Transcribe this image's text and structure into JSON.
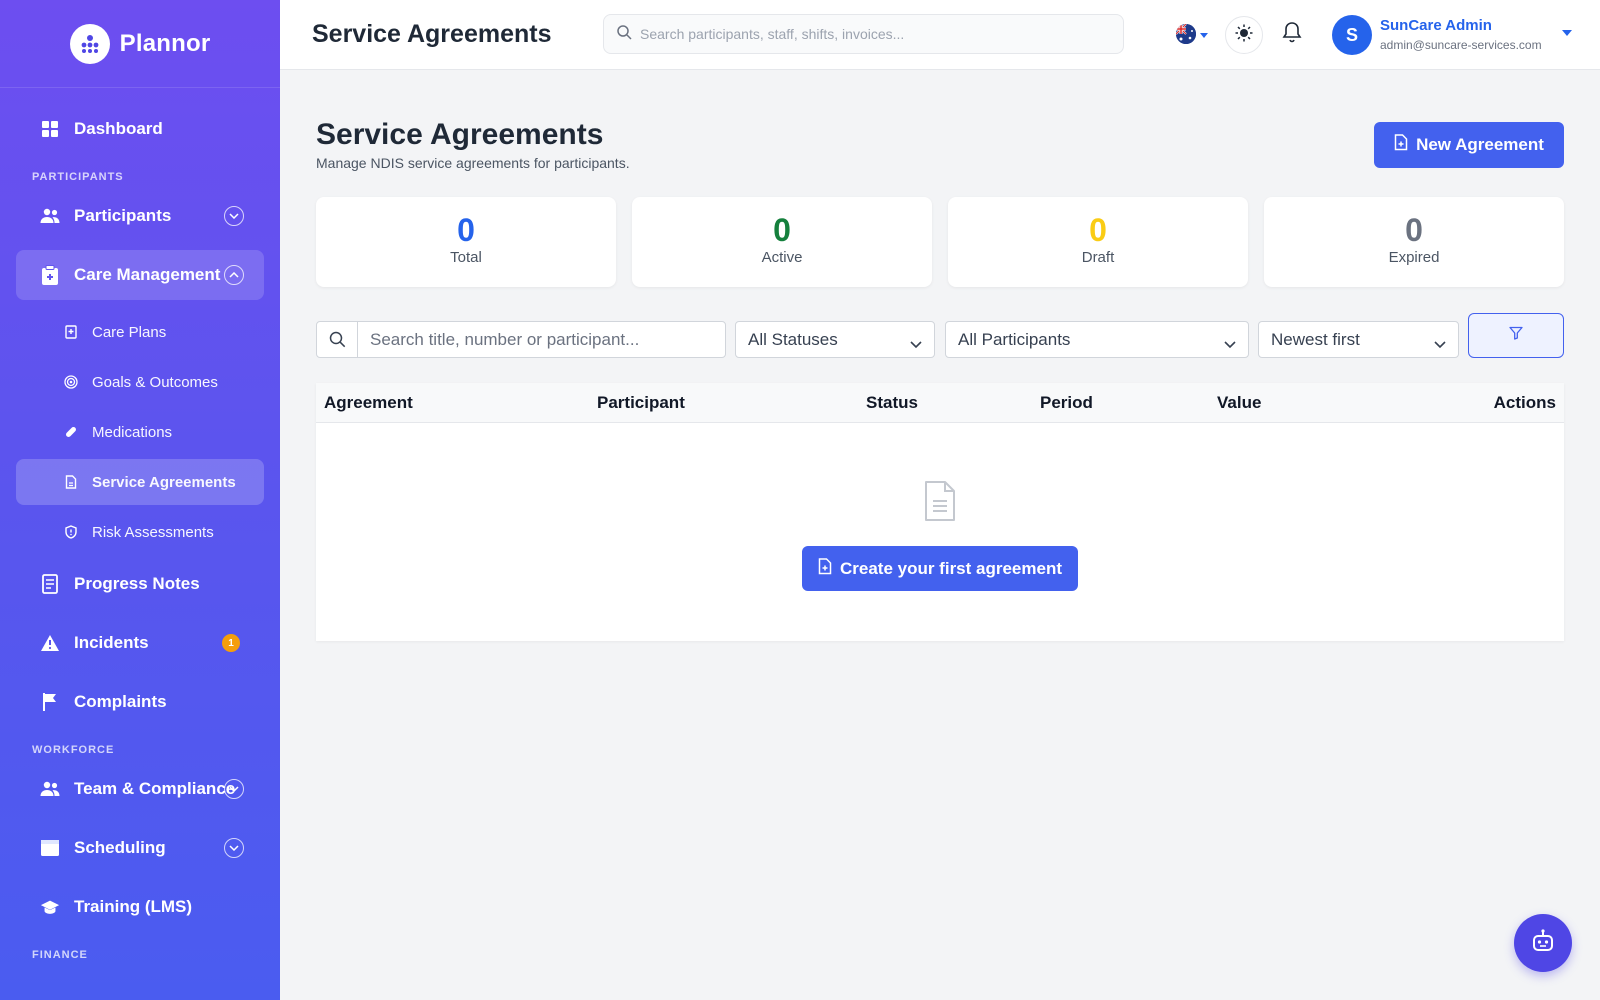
{
  "brand": {
    "name": "Plannor"
  },
  "sidebar": {
    "dashboard": "Dashboard",
    "section_participants": "PARTICIPANTS",
    "participants": "Participants",
    "care_management": "Care Management",
    "care_plans": "Care Plans",
    "goals_outcomes": "Goals & Outcomes",
    "medications": "Medications",
    "service_agreements": "Service Agreements",
    "risk_assessments": "Risk Assessments",
    "progress_notes": "Progress Notes",
    "incidents": "Incidents",
    "incidents_badge": "1",
    "complaints": "Complaints",
    "section_workforce": "WORKFORCE",
    "team_compliance": "Team & Compliance",
    "scheduling": "Scheduling",
    "training": "Training (LMS)",
    "section_finance": "FINANCE"
  },
  "header": {
    "title": "Service Agreements",
    "search_placeholder": "Search participants, staff, shifts, invoices...",
    "user_initial": "S",
    "user_name": "SunCare Admin",
    "user_email": "admin@suncare-services.com"
  },
  "page": {
    "title": "Service Agreements",
    "subtitle": "Manage NDIS service agreements for participants.",
    "new_button": "New Agreement"
  },
  "stats": [
    {
      "value": "0",
      "label": "Total",
      "color": "#2563eb"
    },
    {
      "value": "0",
      "label": "Active",
      "color": "#15803d"
    },
    {
      "value": "0",
      "label": "Draft",
      "color": "#facc15"
    },
    {
      "value": "0",
      "label": "Expired",
      "color": "#6b7280"
    }
  ],
  "filters": {
    "search_placeholder": "Search title, number or participant...",
    "status": "All Statuses",
    "participant": "All Participants",
    "sort": "Newest first"
  },
  "table": {
    "columns": [
      "Agreement",
      "Participant",
      "Status",
      "Period",
      "Value",
      "Actions"
    ],
    "empty_button": "Create your first agreement"
  }
}
